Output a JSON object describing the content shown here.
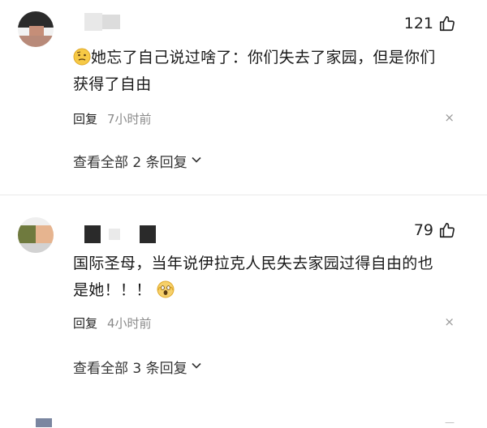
{
  "comments": [
    {
      "likes": "121",
      "text_line1": "她忘了自己说过啥了：你们失去了家园，但是你们",
      "text_line2": "获得了自由",
      "reply_label": "回复",
      "time": "7小时前",
      "close": "×",
      "view_replies": "查看全部 2 条回复"
    },
    {
      "likes": "79",
      "text_line1": "国际圣母，当年说伊拉克人民失去家园过得自由的也",
      "text_line2": "是她！！！",
      "reply_label": "回复",
      "time": "4小时前",
      "close": "×",
      "view_replies": "查看全部 3 条回复"
    }
  ],
  "icons": {
    "like": "thumbs-up-icon",
    "chevron": "chevron-down-icon",
    "emoji1": "thinking-face-emoji",
    "emoji2": "screaming-face-emoji"
  },
  "colors": {
    "time": "#8a8a8a",
    "text": "#1a1a1a",
    "close": "#9a9a9a"
  }
}
